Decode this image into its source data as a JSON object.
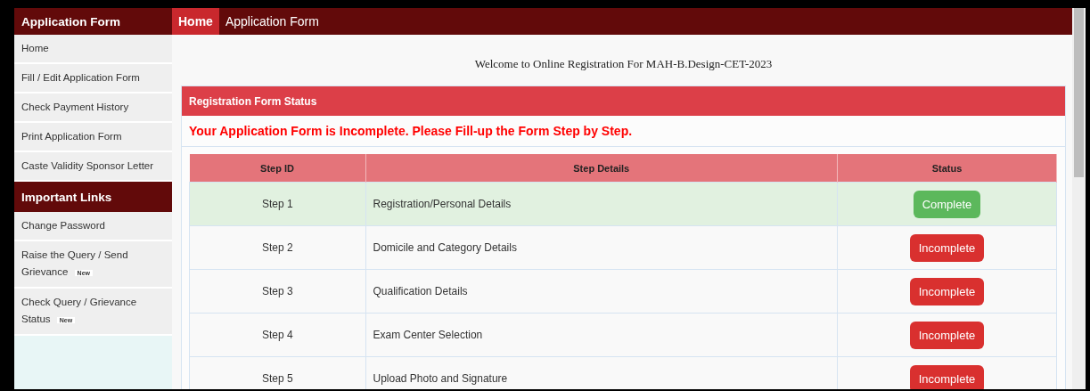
{
  "sidebar": {
    "title": "Application Form",
    "items": [
      {
        "label": "Home"
      },
      {
        "label": "Fill / Edit Application Form"
      },
      {
        "label": "Check Payment History"
      },
      {
        "label": "Print Application Form"
      },
      {
        "label": "Caste Validity Sponsor Letter"
      }
    ],
    "links_title": "Important Links",
    "links": [
      {
        "label": "Change Password"
      },
      {
        "label": "Raise the Query / Send Grievance",
        "badge": "New"
      },
      {
        "label": "Check Query / Grievance Status",
        "badge": "New"
      }
    ]
  },
  "topbar": {
    "tabs": [
      {
        "label": "Home",
        "selected": true
      },
      {
        "label": "Application Form",
        "selected": false
      }
    ]
  },
  "welcome": "Welcome to Online Registration For MAH-B.Design-CET-2023",
  "panel": {
    "title": "Registration Form Status",
    "message": "Your Application Form is Incomplete. Please Fill-up the Form Step by Step.",
    "table": {
      "columns": [
        "Step ID",
        "Step Details",
        "Status"
      ],
      "rows": [
        {
          "step": "Step 1",
          "details": "Registration/Personal Details",
          "status": {
            "kind": "complete",
            "label": "Complete"
          }
        },
        {
          "step": "Step 2",
          "details": "Domicile and Category Details",
          "status": {
            "kind": "incomplete",
            "label": "Incomplete"
          }
        },
        {
          "step": "Step 3",
          "details": "Qualification Details",
          "status": {
            "kind": "incomplete",
            "label": "Incomplete"
          }
        },
        {
          "step": "Step 4",
          "details": "Exam Center Selection",
          "status": {
            "kind": "incomplete",
            "label": "Incomplete"
          }
        },
        {
          "step": "Step 5",
          "details": "Upload Photo and Signature",
          "status": {
            "kind": "incomplete",
            "label": "Incomplete"
          }
        }
      ]
    }
  }
}
